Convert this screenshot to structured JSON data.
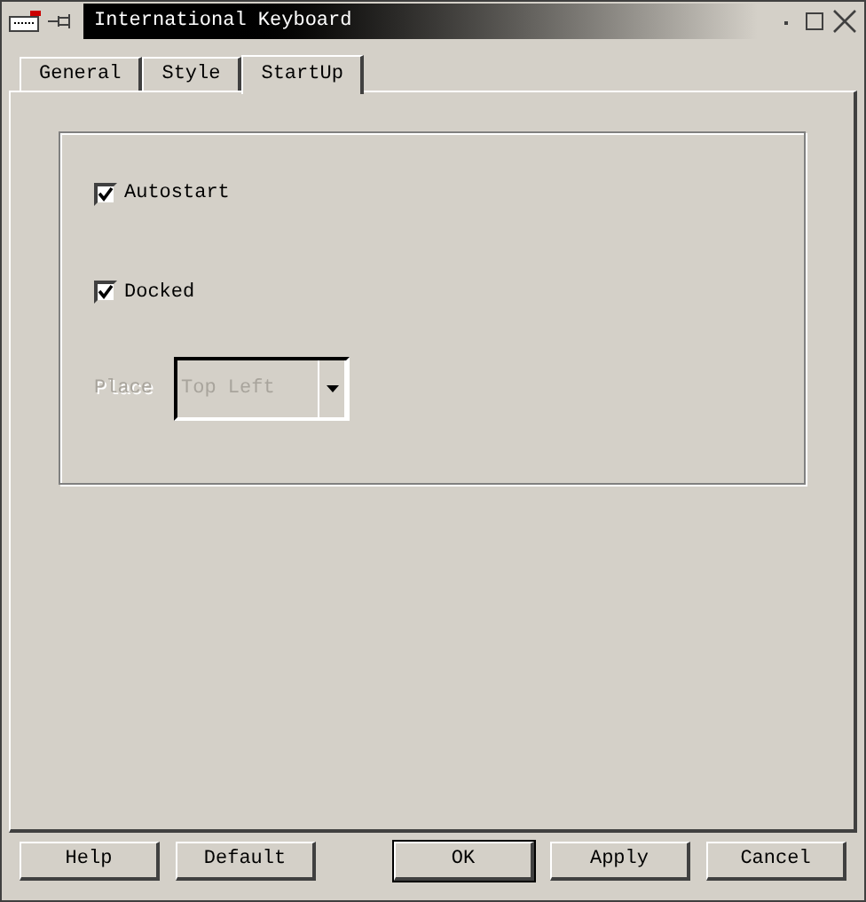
{
  "window": {
    "title": "International Keyboard"
  },
  "tabs": [
    {
      "label": "General",
      "selected": false
    },
    {
      "label": "Style",
      "selected": false
    },
    {
      "label": "StartUp",
      "selected": true
    }
  ],
  "options": [
    {
      "label": "Autostart",
      "checked": true
    },
    {
      "label": "Docked",
      "checked": true
    }
  ],
  "place": {
    "label": "Place",
    "value": "Top Left",
    "disabled": true
  },
  "buttons": [
    {
      "label": "Help",
      "default": false
    },
    {
      "label": "Default",
      "default": false
    },
    {
      "label": "OK",
      "default": true
    },
    {
      "label": "Apply",
      "default": false
    },
    {
      "label": "Cancel",
      "default": false
    }
  ]
}
